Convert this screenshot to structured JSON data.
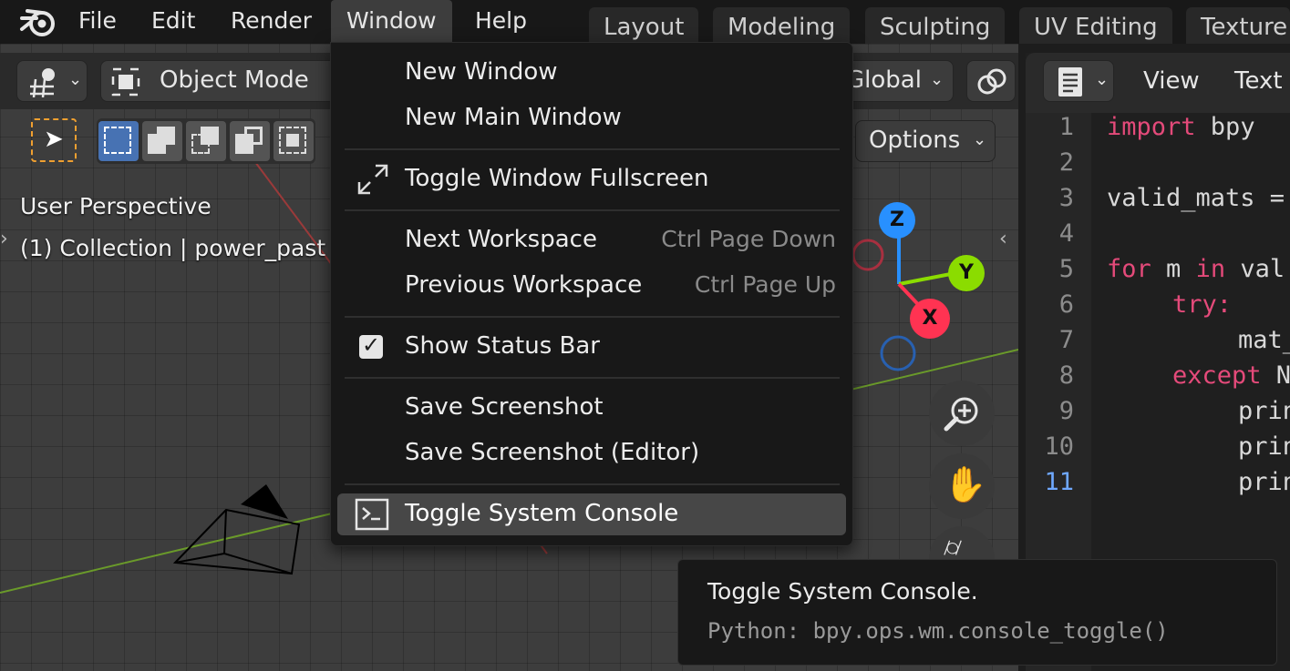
{
  "top_menu": [
    "File",
    "Edit",
    "Render",
    "Window",
    "Help"
  ],
  "workspace_tabs": [
    "Layout",
    "Modeling",
    "Sculpting",
    "UV Editing",
    "Texture"
  ],
  "viewport": {
    "mode": "Object Mode",
    "orientation": "Global",
    "options_label": "Options",
    "perspective_label": "User Perspective",
    "collection_label": "(1) Collection | power_past",
    "axes": {
      "z": "Z",
      "y": "Y",
      "x": "X"
    }
  },
  "window_menu": {
    "items": [
      {
        "label": "New Window",
        "shortcut": ""
      },
      {
        "label": "New Main Window",
        "shortcut": ""
      },
      {
        "label": "Toggle Window Fullscreen",
        "shortcut": ""
      },
      {
        "label": "Next Workspace",
        "shortcut": "Ctrl Page Down"
      },
      {
        "label": "Previous Workspace",
        "shortcut": "Ctrl Page Up"
      },
      {
        "label": "Show Status Bar",
        "shortcut": ""
      },
      {
        "label": "Save Screenshot",
        "shortcut": ""
      },
      {
        "label": "Save Screenshot (Editor)",
        "shortcut": ""
      },
      {
        "label": "Toggle System Console",
        "shortcut": ""
      }
    ],
    "show_status_bar_checked": true,
    "highlighted": "Toggle System Console"
  },
  "text_editor": {
    "menu": [
      "View",
      "Text"
    ],
    "line_numbers": [
      "1",
      "2",
      "3",
      "4",
      "5",
      "6",
      "7",
      "8",
      "9",
      "10",
      "11"
    ],
    "current_line": "11",
    "code": {
      "l1_kw": "import",
      "l1_rest": " bpy",
      "l3": "valid_mats =",
      "l5_kw1": "for",
      "l5_mid": " m ",
      "l5_kw2": "in",
      "l5_rest": " val",
      "l6_kw": "try",
      "l6_rest": ":",
      "l7": "mat_",
      "l8_kw": "except",
      "l8_rest": " N",
      "l9": "prin",
      "l10": "prin",
      "l11": "prin"
    }
  },
  "tooltip": {
    "title": "Toggle System Console.",
    "python": "Python: bpy.ops.wm.console_toggle()"
  },
  "colors": {
    "accent": "#4772b3",
    "axis_x": "#ff3352",
    "axis_y": "#8bdc00",
    "axis_z": "#2890ff",
    "keyword": "#e44a7a"
  }
}
